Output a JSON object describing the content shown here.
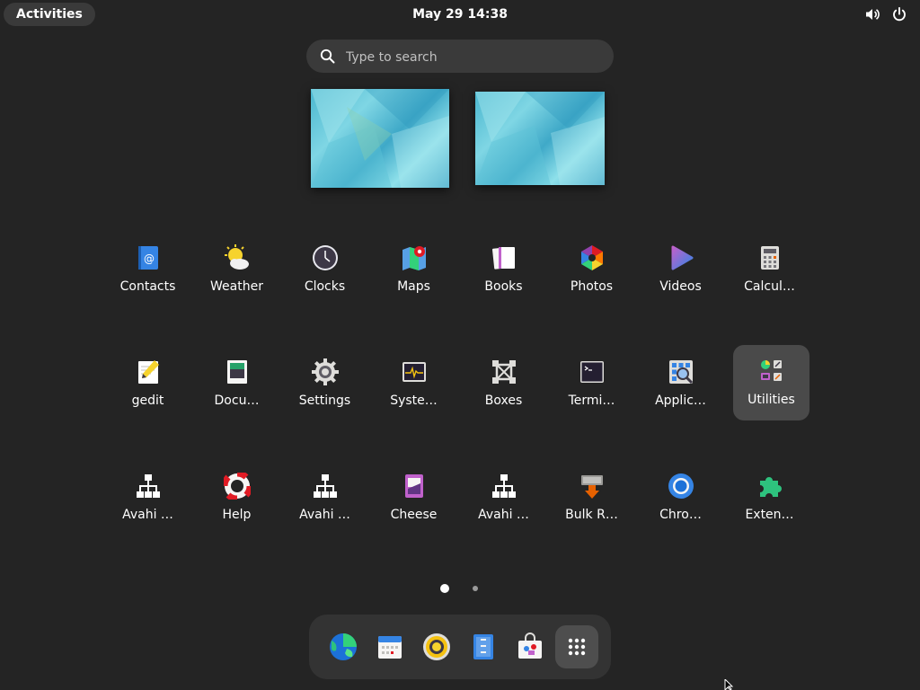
{
  "topbar": {
    "activities_label": "Activities",
    "clock": "May 29  14:38",
    "tray_icons": [
      "volume-icon",
      "power-icon"
    ]
  },
  "search": {
    "placeholder": "Type to search",
    "value": ""
  },
  "workspaces": [
    "workspace-1",
    "workspace-2"
  ],
  "app_grid": {
    "apps": [
      {
        "label": "Contacts",
        "icon": "contacts-icon"
      },
      {
        "label": "Weather",
        "icon": "weather-icon"
      },
      {
        "label": "Clocks",
        "icon": "clocks-icon"
      },
      {
        "label": "Maps",
        "icon": "maps-icon"
      },
      {
        "label": "Books",
        "icon": "books-icon"
      },
      {
        "label": "Photos",
        "icon": "photos-icon"
      },
      {
        "label": "Videos",
        "icon": "videos-icon"
      },
      {
        "label": "Calcul…",
        "icon": "calculator-icon"
      },
      {
        "label": "gedit",
        "icon": "gedit-icon"
      },
      {
        "label": "Docu…",
        "icon": "document-viewer-icon"
      },
      {
        "label": "Settings",
        "icon": "settings-icon"
      },
      {
        "label": "Syste…",
        "icon": "system-monitor-icon"
      },
      {
        "label": "Boxes",
        "icon": "boxes-icon"
      },
      {
        "label": "Termi…",
        "icon": "terminal-icon"
      },
      {
        "label": "Applic…",
        "icon": "application-finder-icon"
      },
      {
        "label": "Utilities",
        "icon": "utilities-folder-icon",
        "selected": true
      },
      {
        "label": "Avahi …",
        "icon": "network-icon"
      },
      {
        "label": "Help",
        "icon": "help-icon"
      },
      {
        "label": "Avahi …",
        "icon": "network-icon"
      },
      {
        "label": "Cheese",
        "icon": "cheese-icon"
      },
      {
        "label": "Avahi …",
        "icon": "network-icon"
      },
      {
        "label": "Bulk R…",
        "icon": "bulk-rename-icon"
      },
      {
        "label": "Chro…",
        "icon": "chromium-icon"
      },
      {
        "label": "Exten…",
        "icon": "extensions-icon"
      }
    ]
  },
  "pagination": {
    "current_page": 1,
    "total_pages": 2
  },
  "dock": {
    "items": [
      "browser-icon",
      "calendar-icon",
      "rhythmbox-icon",
      "files-icon",
      "software-icon",
      "show-apps-icon"
    ]
  },
  "colors": {
    "background": "#242424",
    "panel": "#3a3a3a",
    "selected": "#4a4a4a",
    "dock": "#333333"
  }
}
